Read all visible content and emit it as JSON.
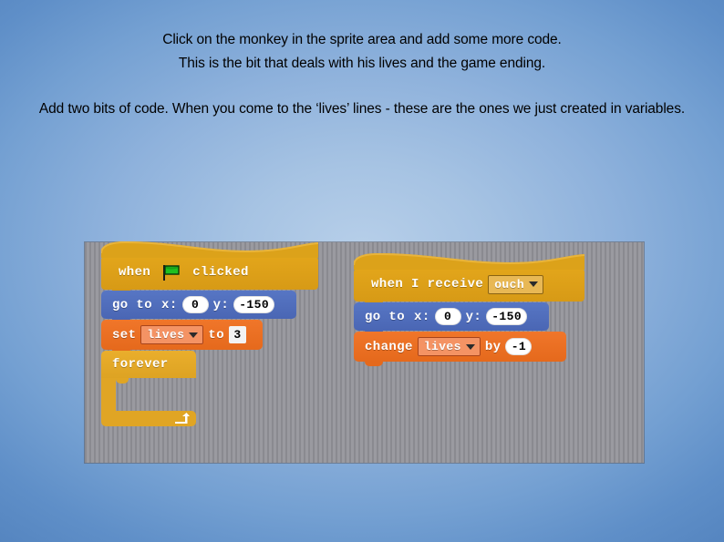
{
  "slide": {
    "background_color": "#8fb2dc",
    "paragraphs": [
      {
        "id": "para1",
        "lines": [
          "Click on the monkey in the sprite area and add some more code.",
          "This is the bit that deals with his lives and the game ending."
        ]
      },
      {
        "id": "para2",
        "lines": [
          "Add two bits of code.  When you come to the ‘lives’ lines - these are the ones we just created in variables."
        ]
      }
    ]
  },
  "scratch_panel": {
    "background_color": "#8d8d93",
    "scripts": [
      {
        "name": "green-flag-script",
        "blocks": [
          {
            "type": "hat",
            "category": "events",
            "color": "#e3a61b",
            "words": {
              "before": "when",
              "after": "clicked"
            },
            "icon": "green-flag-icon"
          },
          {
            "type": "stack",
            "category": "motion",
            "color": "#4a66b4",
            "label_go_to": "go to",
            "label_x": "x:",
            "value_x": "0",
            "label_y": "y:",
            "value_y": "-150"
          },
          {
            "type": "stack",
            "category": "data",
            "color": "#e5691c",
            "label_set": "set",
            "variable": "lives",
            "label_to": "to",
            "value": "3"
          },
          {
            "type": "c-block",
            "category": "control",
            "color": "#e0a524",
            "label": "forever",
            "icon": "loop-arrow-icon"
          }
        ]
      },
      {
        "name": "receive-ouch-script",
        "blocks": [
          {
            "type": "hat",
            "category": "events",
            "color": "#e3a61b",
            "label": "when I receive",
            "message": "ouch"
          },
          {
            "type": "stack",
            "category": "motion",
            "color": "#4a66b4",
            "label_go_to": "go to",
            "label_x": "x:",
            "value_x": "0",
            "label_y": "y:",
            "value_y": "-150"
          },
          {
            "type": "stack",
            "category": "data",
            "color": "#e5691c",
            "label_change": "change",
            "variable": "lives",
            "label_by": "by",
            "value": "-1"
          }
        ]
      }
    ]
  }
}
